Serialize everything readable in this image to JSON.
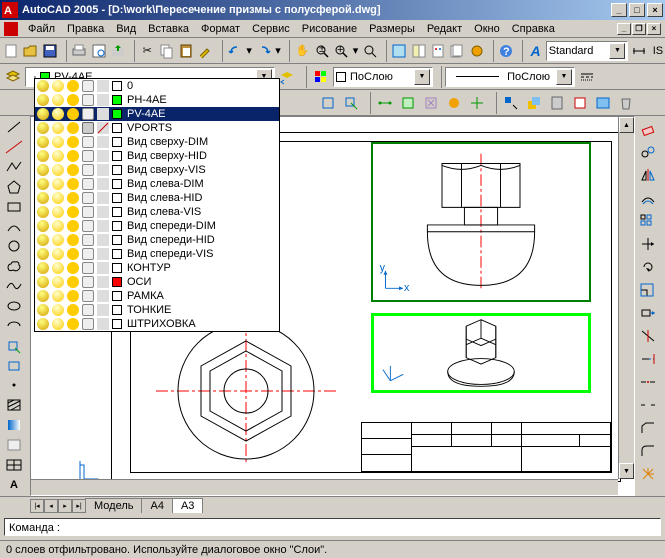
{
  "titlebar": {
    "app": "AutoCAD 2005",
    "doc": "[D:\\work\\Пересечение призмы с полусферой.dwg]"
  },
  "menu": {
    "file": "Файл",
    "edit": "Правка",
    "view": "Вид",
    "insert": "Вставка",
    "format": "Формат",
    "tools": "Сервис",
    "draw": "Рисование",
    "dimension": "Размеры",
    "modify": "Редакт",
    "window": "Окно",
    "help": "Справка"
  },
  "toolbar1": {
    "style_combo": "Standard",
    "extra": "IS"
  },
  "layer": {
    "current": "PV-4AE",
    "color_combo": "ПоСлою",
    "ltype_combo": "ПоСлою",
    "items": [
      {
        "name": "0",
        "color": "#ffffff",
        "plot": true
      },
      {
        "name": "PH-4AE",
        "color": "#00ff00",
        "plot": true
      },
      {
        "name": "PV-4AE",
        "color": "#00ff00",
        "plot": true,
        "selected": true
      },
      {
        "name": "VPORTS",
        "color": "#ffffff",
        "plot": false
      },
      {
        "name": "Вид сверху-DIM",
        "color": "#ffffff",
        "plot": true
      },
      {
        "name": "Вид сверху-HID",
        "color": "#ffffff",
        "plot": true
      },
      {
        "name": "Вид сверху-VIS",
        "color": "#ffffff",
        "plot": true
      },
      {
        "name": "Вид слева-DIM",
        "color": "#ffffff",
        "plot": true
      },
      {
        "name": "Вид слева-HID",
        "color": "#ffffff",
        "plot": true
      },
      {
        "name": "Вид слева-VIS",
        "color": "#ffffff",
        "plot": true
      },
      {
        "name": "Вид спереди-DIM",
        "color": "#ffffff",
        "plot": true
      },
      {
        "name": "Вид спереди-HID",
        "color": "#ffffff",
        "plot": true
      },
      {
        "name": "Вид спереди-VIS",
        "color": "#ffffff",
        "plot": true
      },
      {
        "name": "КОНТУР",
        "color": "#ffffff",
        "plot": true
      },
      {
        "name": "ОСИ",
        "color": "#ff0000",
        "plot": true
      },
      {
        "name": "РАМКА",
        "color": "#ffffff",
        "plot": true
      },
      {
        "name": "ТОНКИЕ",
        "color": "#ffffff",
        "plot": true
      },
      {
        "name": "ШТРИХОВКА",
        "color": "#ffffff",
        "plot": true
      }
    ]
  },
  "tabs": {
    "model": "Модель",
    "a4": "A4",
    "a3": "A3"
  },
  "command": {
    "prompt": "Команда :"
  },
  "status": {
    "text": "0 слоев отфильтровано.  Используйте диалоговое окно \"Слои\"."
  }
}
